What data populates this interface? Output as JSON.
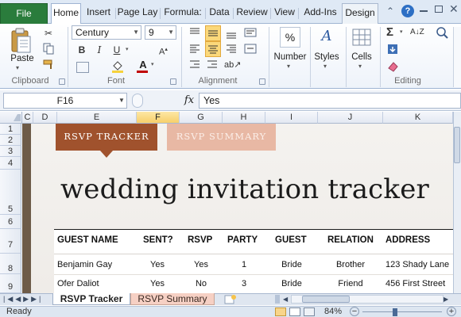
{
  "ribbon_tabs": {
    "file": "File",
    "home": "Home",
    "insert": "Insert",
    "page_layout": "Page Lay",
    "formulas": "Formula:",
    "data": "Data",
    "review": "Review",
    "view": "View",
    "addins": "Add-Ins",
    "design": "Design"
  },
  "ribbon": {
    "clipboard": {
      "paste": "Paste",
      "label": "Clipboard"
    },
    "font": {
      "name": "Century",
      "size": "9",
      "bold": "B",
      "italic": "I",
      "underline": "U",
      "font_color_glyph": "A",
      "label": "Font",
      "accent_fill": "#f6d23b",
      "accent_font": "#c00000"
    },
    "alignment": {
      "label": "Alignment"
    },
    "number": {
      "symbol": "%",
      "label": "Number"
    },
    "styles": {
      "symbol": "A",
      "label": "Styles"
    },
    "cells": {
      "label": "Cells"
    },
    "editing": {
      "autosum": "Σ",
      "label": "Editing"
    }
  },
  "formula_bar": {
    "name_box": "F16",
    "fx": "fx",
    "value": "Yes"
  },
  "columns": [
    "C",
    "D",
    "E",
    "F",
    "G",
    "H",
    "I",
    "J",
    "K"
  ],
  "rows": [
    "1",
    "2",
    "3",
    "4",
    "5",
    "6",
    "7",
    "8",
    "9"
  ],
  "sheet": {
    "tab_active": "RSVP TRACKER",
    "tab_inactive": "RSVP SUMMARY",
    "title": "wedding invitation tracker",
    "headers": [
      "GUEST NAME",
      "SENT?",
      "RSVP",
      "PARTY",
      "GUEST",
      "RELATION",
      "ADDRESS"
    ],
    "rows": [
      [
        "Benjamin Gay",
        "Yes",
        "Yes",
        "1",
        "Bride",
        "Brother",
        "123 Shady Lane"
      ],
      [
        "Ofer Daliot",
        "Yes",
        "No",
        "3",
        "Bride",
        "Friend",
        "456 First Street"
      ]
    ],
    "colors": {
      "tab_active": "#a0522d",
      "tab_inactive": "#e8b8a4",
      "paper": "#f3f1ee"
    }
  },
  "sheet_tabs": [
    "RSVP Tracker",
    "RSVP Summary"
  ],
  "status": {
    "ready": "Ready",
    "zoom": "84%",
    "minus": "−",
    "plus": "+"
  },
  "icons": [
    "paste-icon",
    "cut-icon",
    "copy-icon",
    "format-painter-icon",
    "help-icon",
    "minimize-icon",
    "restore-icon",
    "close-icon",
    "ribbon-collapse-icon",
    "sort-filter-icon",
    "find-icon"
  ]
}
